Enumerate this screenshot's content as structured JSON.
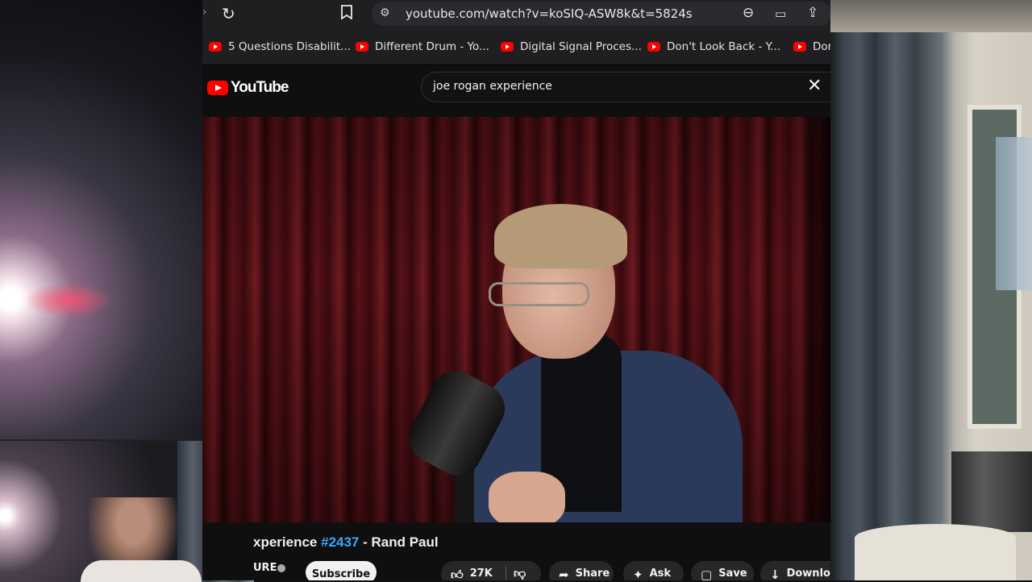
{
  "browser": {
    "url": "youtube.com/watch?v=koSIQ-ASW8k&t=5824s",
    "bookmarks": [
      {
        "label": "5 Questions Disabilit..."
      },
      {
        "label": "Different Drum - Yo..."
      },
      {
        "label": "Digital Signal Proces..."
      },
      {
        "label": "Don't Look Back - Y..."
      },
      {
        "label": "Dor"
      }
    ]
  },
  "youtube": {
    "logo_text": "YouTube",
    "search_query": "joe rogan experience",
    "video": {
      "title_prefix": "xperience ",
      "episode_tag": "#2437",
      "title_suffix": " - Rand Paul",
      "channel": "URE",
      "subscribe_label": "Subscribe",
      "likes": "27K",
      "share_label": "Share",
      "ask_label": "Ask",
      "save_label": "Save",
      "download_label": "Download"
    }
  },
  "colors": {
    "accent_red": "#ff0000",
    "link_blue": "#3ea6ff",
    "page_bg": "#0f0f0f"
  },
  "icons": [
    "forward-icon",
    "reload-icon",
    "bookmark-icon",
    "site-settings-icon",
    "zoom-icon",
    "cast-icon",
    "share-page-icon",
    "youtube-favicon",
    "clear-search-icon",
    "like-icon",
    "dislike-icon",
    "share-icon",
    "ask-icon",
    "save-icon",
    "download-icon",
    "verified-icon"
  ]
}
